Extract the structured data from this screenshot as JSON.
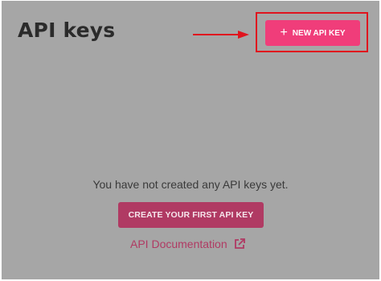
{
  "header": {
    "title": "API keys"
  },
  "toolbar": {
    "new_key_label": "NEW API KEY",
    "plus_icon": "+"
  },
  "annotation": {
    "arrow_color": "#e0141e",
    "highlight_color": "#e0141e"
  },
  "empty_state": {
    "message": "You have not created any API keys yet.",
    "create_button_label": "CREATE YOUR FIRST API KEY",
    "docs_link_label": "API Documentation",
    "docs_link_icon": "external-link-icon"
  },
  "colors": {
    "background_overlay": "#a6a6a6",
    "accent": "#f03d7a",
    "accent_dimmed": "#b03a63"
  }
}
